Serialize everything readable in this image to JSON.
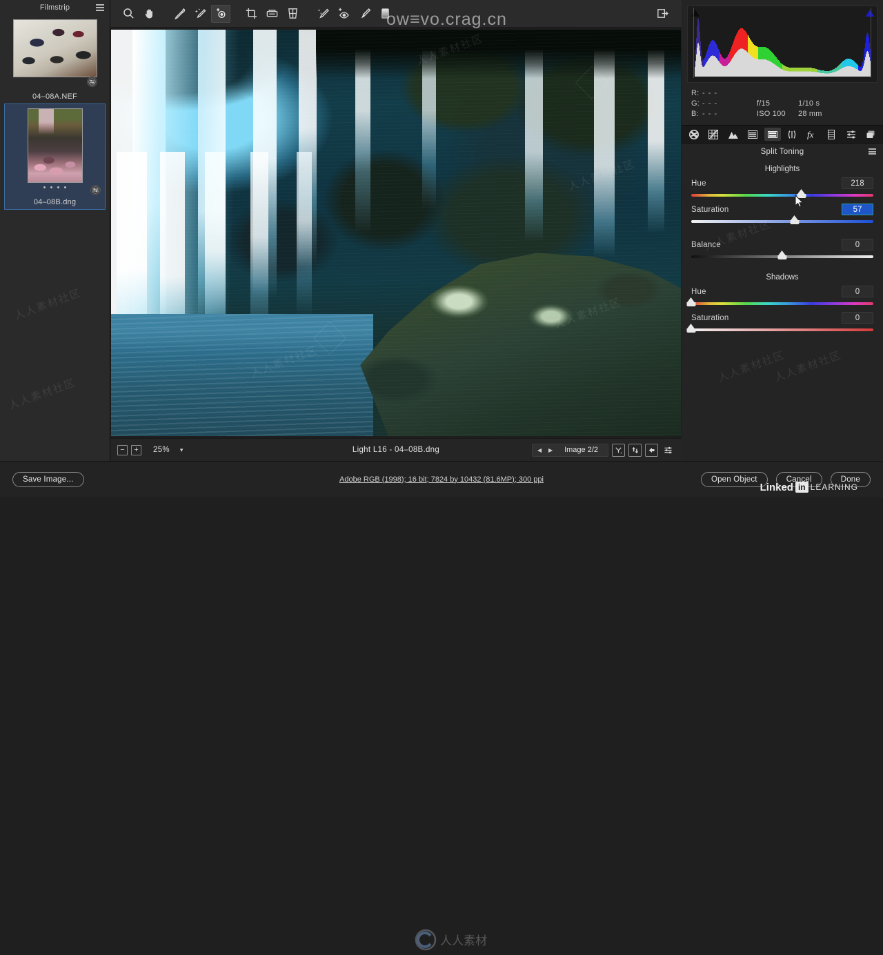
{
  "app": {
    "name": "Adobe Camera Raw",
    "watermark_url": "ow≡vo.crag.cn",
    "watermark_brand": {
      "linked": "Linked",
      "in": "in",
      "learning": "LEARNING"
    },
    "watermark_site": "人人素材社区"
  },
  "filmstrip": {
    "title": "Filmstrip",
    "menu_icon": "hamburger-icon",
    "items": [
      {
        "label": "04–08A.NEF",
        "selected": false,
        "badge_icon": "adjust-badge-icon",
        "rating_dots": 0,
        "orientation": "landscape"
      },
      {
        "label": "04–08B.dng",
        "selected": true,
        "badge_icon": "adjust-badge-icon",
        "rating_dots": 4,
        "orientation": "portrait"
      }
    ]
  },
  "toolbar": {
    "tools": [
      {
        "name": "zoom-tool",
        "icon": "magnifier-icon",
        "active": false
      },
      {
        "name": "hand-tool",
        "icon": "hand-icon",
        "active": false
      },
      {
        "name": "white-balance-tool",
        "icon": "eyedropper-icon",
        "active": false
      },
      {
        "name": "color-sampler-tool",
        "icon": "sparkle-eyedropper-icon",
        "active": false
      },
      {
        "name": "targeted-adjustment-tool",
        "icon": "target-adjust-icon",
        "active": true
      },
      {
        "name": "crop-tool",
        "icon": "crop-icon",
        "active": false
      },
      {
        "name": "straighten-tool",
        "icon": "straighten-icon",
        "active": false
      },
      {
        "name": "transform-tool",
        "icon": "transform-grid-icon",
        "active": false
      },
      {
        "name": "spot-removal-tool",
        "icon": "healing-brush-icon",
        "active": false
      },
      {
        "name": "red-eye-tool",
        "icon": "red-eye-icon",
        "active": false
      },
      {
        "name": "adjustment-brush-tool",
        "icon": "paint-brush-icon",
        "active": false
      },
      {
        "name": "graduated-filter-tool",
        "icon": "gradient-rect-icon",
        "active": false
      }
    ],
    "preferences": {
      "name": "open-preferences-button",
      "icon": "panel-export-icon"
    }
  },
  "histogram": {
    "shadow_clip_icon": "shadow-clipping-triangle",
    "highlight_clip_icon": "highlight-clipping-triangle",
    "highlight_clip_color": "#1b1bd8",
    "shadow_clip_color": "#0b0b0b",
    "readout": {
      "r_label": "R:",
      "r_value": "- - -",
      "g_label": "G:",
      "g_value": "- - -",
      "b_label": "B:",
      "b_value": "- - -"
    },
    "exif": {
      "aperture": "f/15",
      "shutter": "1/10 s",
      "iso": "ISO 100",
      "focal": "28 mm"
    }
  },
  "panel_tabs": [
    {
      "name": "tab-basic",
      "icon": "aperture-icon",
      "active": false
    },
    {
      "name": "tab-tone-curve",
      "icon": "tone-curve-icon",
      "active": false
    },
    {
      "name": "tab-detail",
      "icon": "mountains-icon",
      "active": false
    },
    {
      "name": "tab-hsl-grayscale",
      "icon": "hsl-sliders-icon",
      "active": false
    },
    {
      "name": "tab-split-toning",
      "icon": "split-toning-icon",
      "active": true
    },
    {
      "name": "tab-lens-corrections",
      "icon": "lens-correction-icon",
      "active": false
    },
    {
      "name": "tab-effects",
      "icon": "fx-icon",
      "active": false
    },
    {
      "name": "tab-camera-calibration",
      "icon": "film-frame-icon",
      "active": false
    },
    {
      "name": "tab-presets",
      "icon": "presets-sliders-icon",
      "active": false
    },
    {
      "name": "tab-snapshots",
      "icon": "snapshots-stack-icon",
      "active": false
    }
  ],
  "split_toning": {
    "panel_title": "Split Toning",
    "panel_menu_icon": "hamburger-icon",
    "highlights": {
      "section_label": "Highlights",
      "hue": {
        "label": "Hue",
        "value": "218",
        "pct": 60.5,
        "selected": false
      },
      "saturation": {
        "label": "Saturation",
        "value": "57",
        "pct": 57.0,
        "selected": true
      }
    },
    "balance": {
      "label": "Balance",
      "value": "0",
      "pct": 50
    },
    "shadows": {
      "section_label": "Shadows",
      "hue": {
        "label": "Hue",
        "value": "0",
        "pct": 0
      },
      "saturation": {
        "label": "Saturation",
        "value": "0",
        "pct": 0
      }
    }
  },
  "canvas_bar": {
    "zoom_out_label": "−",
    "zoom_in_label": "+",
    "zoom_value": "25%",
    "zoom_chevron_icon": "chevron-down-icon",
    "image_title": "Light L16  -  04–08B.dng",
    "nav_prev_icon": "prev-triangle-icon",
    "nav_next_icon": "next-triangle-icon",
    "image_counter": "Image 2/2",
    "buttons": [
      {
        "name": "before-after-y-button",
        "icon": "y-split-icon"
      },
      {
        "name": "swap-before-after-button",
        "icon": "swap-arrows-icon"
      },
      {
        "name": "copy-current-to-before-button",
        "icon": "left-arrow-icon"
      },
      {
        "name": "preview-preferences-button",
        "icon": "sliders-icon"
      }
    ]
  },
  "bottom_bar": {
    "save_image_label": "Save Image...",
    "workflow_info": "Adobe RGB (1998); 16 bit; 7824 by 10432 (81.6MP); 300 ppi",
    "open_object_label": "Open Object",
    "cancel_label": "Cancel",
    "done_label": "Done"
  },
  "colors": {
    "panel_bg": "#242424",
    "canvas_bg": "#1e1e1e",
    "selection_blue": "#1e56c8",
    "filmstrip_select": "#3a6ea8",
    "clip_highlight": "#1b1bd8"
  }
}
